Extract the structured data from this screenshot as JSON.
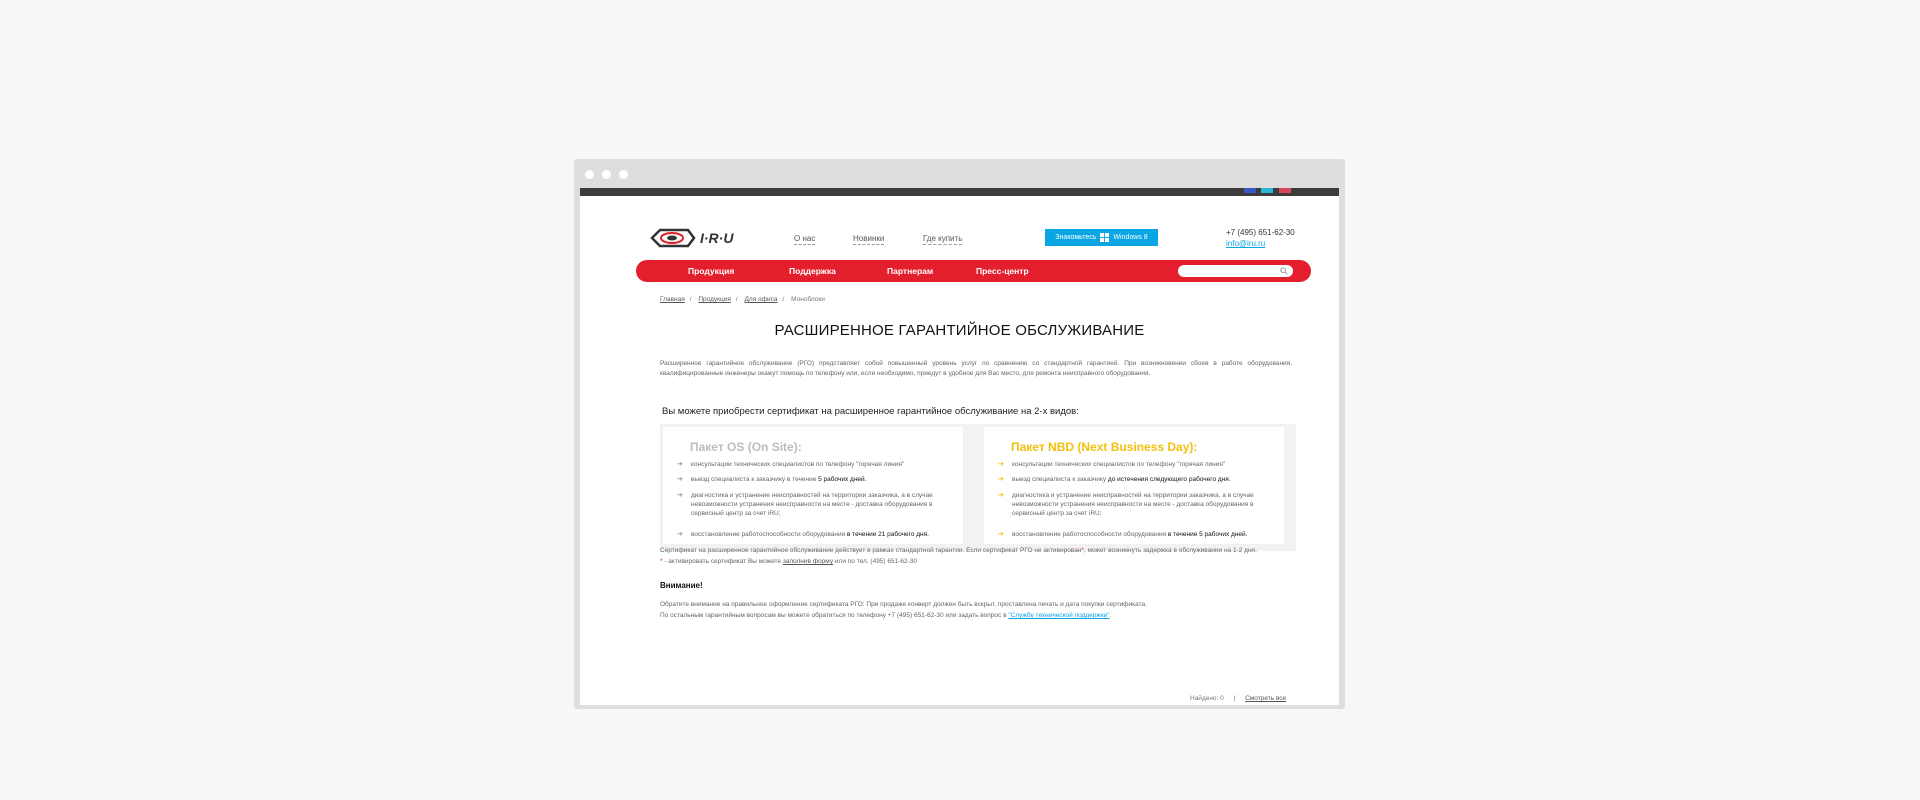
{
  "header": {
    "nav": [
      "О нас",
      "Новинки",
      "Где купить"
    ],
    "windows_btn": {
      "label": "Знакомьтесь",
      "product": "Windows 8"
    },
    "phone": "+7 (495) 651-62-30",
    "email": "info@iru.ru",
    "logo_text": "I·R·U"
  },
  "menu": {
    "items": [
      "Продукция",
      "Поддержка",
      "Партнерам",
      "Пресс-центр"
    ],
    "search_placeholder": ""
  },
  "breadcrumbs": [
    "Главная",
    "Продукция",
    "Для офиса",
    "Моноблоки"
  ],
  "page": {
    "title": "РАСШИРЕННОЕ ГАРАНТИЙНОЕ ОБСЛУЖИВАНИЕ",
    "intro": "Расширенное гарантийное обслуживание (РГО) представляет собой повышенный уровень услуг по сравнению со стандартной гарантией. При возникновении сбоев в работе оборудования, квалифицированные инженеры окажут помощь по телефону или, если необходимо, приедут в удобное для Вас место, для ремонта неисправного оборудования.",
    "subhead": "Вы можете приобрести сертификат на расширенное гарантийное обслуживание на 2-х видов:"
  },
  "packages": [
    {
      "title": "Пакет OS (On Site):",
      "color": "#bdbdbd",
      "items": [
        {
          "text": "консультации технических специалистов по телефону \"горячая линия\"",
          "bold": ""
        },
        {
          "text": "выезд специалиста к заказчику в течение ",
          "bold": "5 рабочих дней."
        },
        {
          "text": "диагностика и устранение неисправностей на территории заказчика, а в случае невозможности устранения неисправности на месте - доставка оборудования в сервисный центр за счет iRU;",
          "bold": ""
        },
        {
          "text": "восстановление работоспособности оборудования ",
          "bold": "в течение 21 рабочего дня."
        }
      ]
    },
    {
      "title": "Пакет NBD (Next Business Day):",
      "color": "#f2c10e",
      "items": [
        {
          "text": "консультации технических специалистов по телефону \"горячая линия\"",
          "bold": ""
        },
        {
          "text": "выезд специалиста к заказчику ",
          "bold": "до истечения следующего рабочего дня."
        },
        {
          "text": "диагностика и устранение неисправностей на территории заказчика, а в случае невозможности устранения неисправности на месте - доставка оборудования в сервисный центр за счет iRU;",
          "bold": ""
        },
        {
          "text": "восстановление работоспособности оборудования ",
          "bold": "в течение 5 рабочих дней."
        }
      ]
    }
  ],
  "notes": {
    "line1_a": "Сертификат на расширенное гарантийное обслуживание действует в рамках стандартной гарантии. Если сертификат РГО не активирован",
    "star": "*",
    "line1_b": ", может возникнуть задержка в обслуживании на 1-2 дня.",
    "line2_a": " - активировать сертификат Вы можете ",
    "line2_link": "заполнив форму",
    "line2_b": "  или по тел. (495) 651-62-30"
  },
  "warning": {
    "title": "Внимание!",
    "line1": "Обратите внимание на правильное оформление сертификата РГО: При продаже конверт должен быть вскрыт, проставлена печать и дата покупки сертификата.",
    "line2_a": "По остальным гарантийным вопросам вы можете обратиться по телефону +7 (495) 651-62-30 или задать вопрос в ",
    "line2_link": "\"Службу технической поддержки\"",
    "line2_b": "."
  },
  "footer": {
    "found": "Найдено: 0",
    "separator": "|",
    "show_all": "Смотреть все"
  },
  "colors": {
    "accent_red": "#e41f2d",
    "accent_blue": "#0aa5e3",
    "nbd_yellow": "#f2c10e"
  }
}
